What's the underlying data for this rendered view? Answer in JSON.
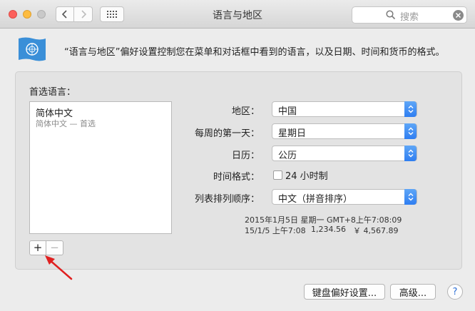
{
  "window": {
    "title": "语言与地区"
  },
  "search": {
    "placeholder": "搜索"
  },
  "header": {
    "description": "“语言与地区”偏好设置控制您在菜单和对话框中看到的语言，以及日期、时间和货币的格式。"
  },
  "languages": {
    "label": "首选语言：",
    "items": [
      {
        "name": "简体中文",
        "detail": "简体中文 — 首选"
      }
    ],
    "add_label": "+",
    "remove_label": "−"
  },
  "settings": {
    "region_label": "地区：",
    "region_value": "中国",
    "first_day_label": "每周的第一天：",
    "first_day_value": "星期日",
    "calendar_label": "日历：",
    "calendar_value": "公历",
    "time_format_label": "时间格式：",
    "time_format_option": "24 小时制",
    "time_format_checked": false,
    "sort_label": "列表排列顺序：",
    "sort_value": "中文（拼音排序）"
  },
  "sample": {
    "line1": "2015年1月5日 星期一 GMT+8上午7:08:09",
    "line2_date": "15/1/5 上午7:08",
    "line2_number": "1,234.56",
    "line2_currency": "￥ 4,567.89"
  },
  "buttons": {
    "keyboard": "键盘偏好设置...",
    "advanced": "高级...",
    "help": "?"
  },
  "colors": {
    "accent": "#2f7ef1",
    "close": "#fc605c",
    "minimize": "#fdbc40",
    "arrow": "#e02020"
  },
  "icons": [
    "back-chevron-icon",
    "forward-chevron-icon",
    "grid-icon",
    "search-icon",
    "clear-icon",
    "un-flag-icon",
    "stepper-icon",
    "arrow-icon"
  ]
}
